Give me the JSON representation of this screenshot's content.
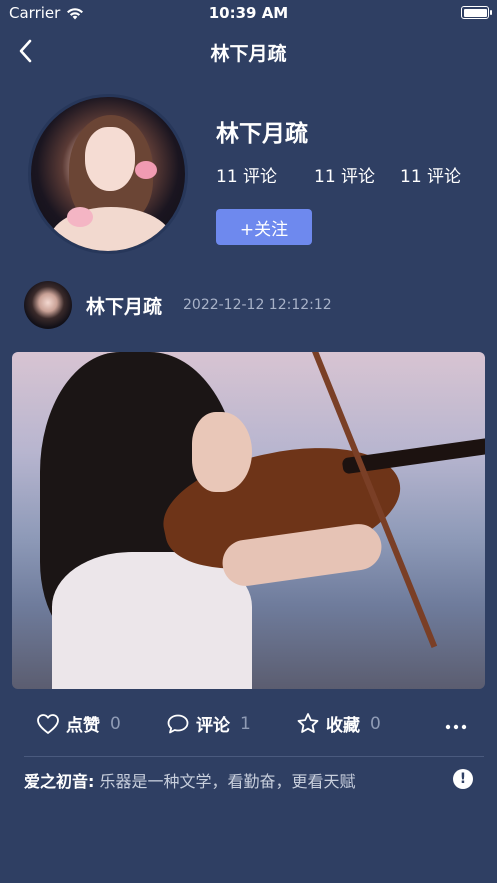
{
  "status_bar": {
    "carrier": "Carrier",
    "time": "10:39 AM"
  },
  "nav": {
    "title": "林下月疏"
  },
  "profile": {
    "name": "林下月疏",
    "stats": [
      "11 评论",
      "11 评论",
      "11 评论"
    ],
    "follow_label": "+关注"
  },
  "post": {
    "author": "林下月疏",
    "time": "2022-12-12 12:12:12",
    "actions": {
      "like_label": "点赞",
      "like_count": "0",
      "comment_label": "评论",
      "comment_count": "1",
      "favorite_label": "收藏",
      "favorite_count": "0"
    },
    "comment": {
      "user": "爱之初音:",
      "text": "乐器是一种文学，看勤奋，更看天赋"
    }
  },
  "colors": {
    "background": "#2f3f63",
    "accent": "#6e89ee"
  },
  "icons": [
    "back-icon",
    "wifi-icon",
    "battery-icon",
    "heart-icon",
    "comment-icon",
    "star-icon",
    "more-icon",
    "report-icon"
  ]
}
